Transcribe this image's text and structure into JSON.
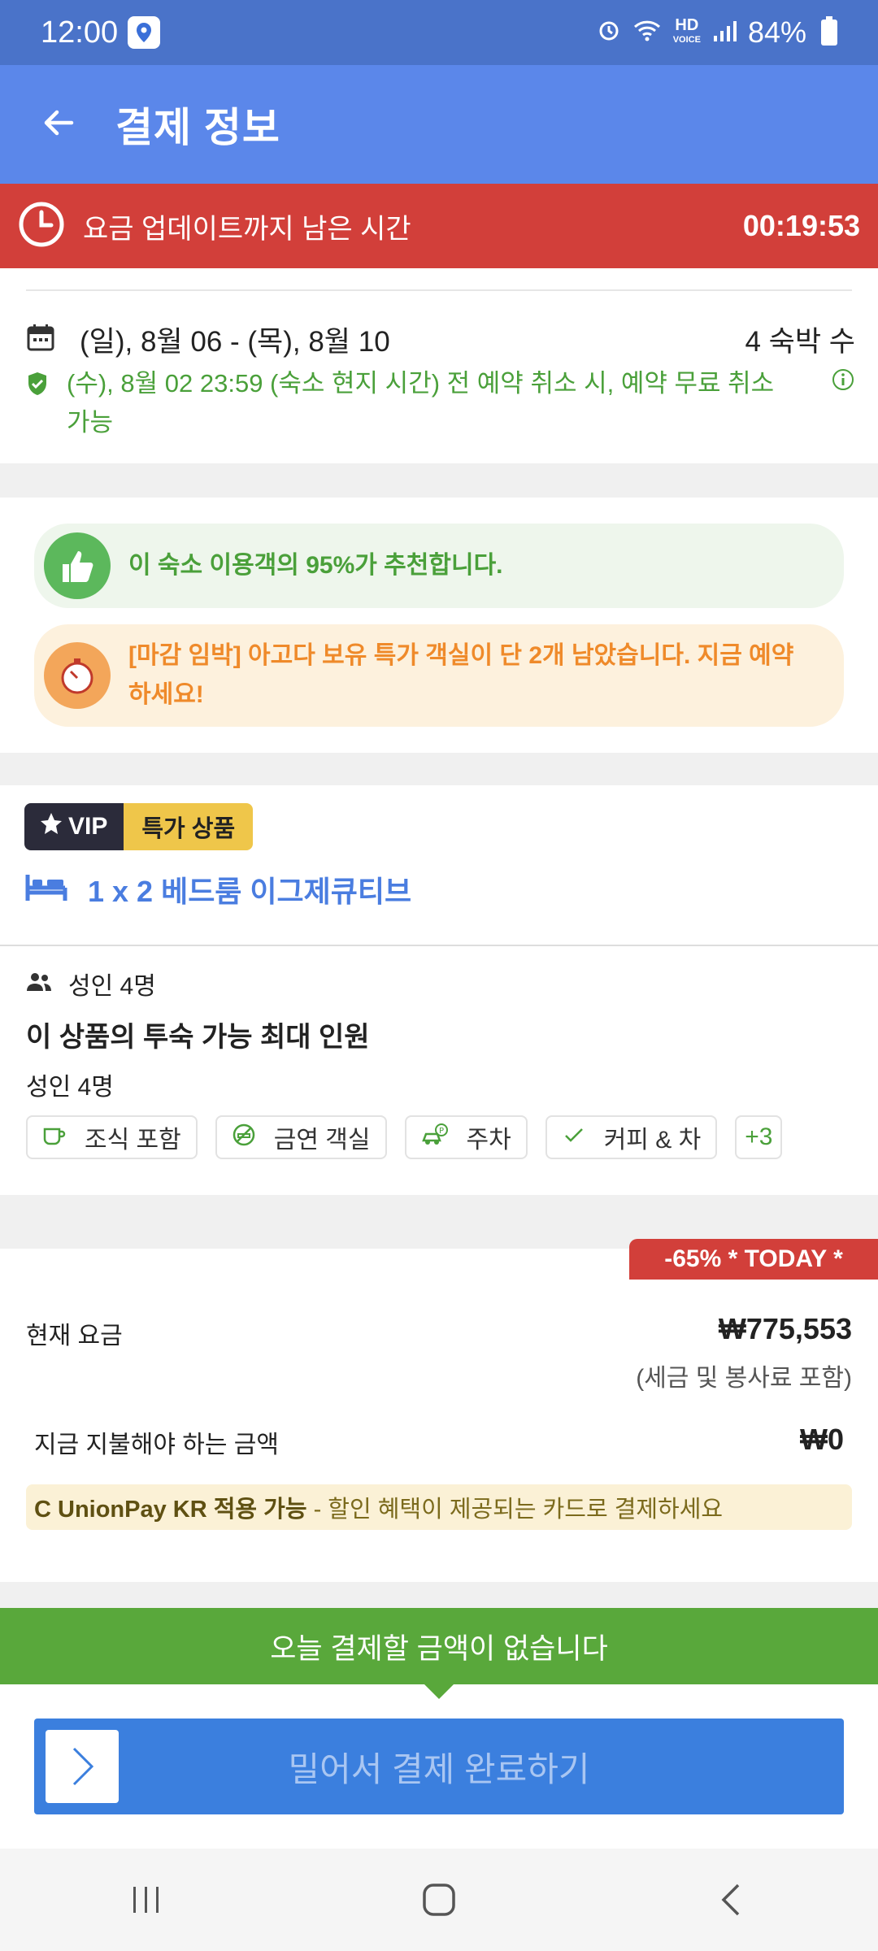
{
  "status_bar": {
    "time": "12:00",
    "battery": "84%",
    "hd_label": "HD",
    "voice_label": "VOICE"
  },
  "app_bar": {
    "title": "결제 정보"
  },
  "timer": {
    "label": "요금 업데이트까지 남은 시간",
    "value": "00:19:53"
  },
  "booking": {
    "dates": "(일), 8월 06 - (목), 8월 10",
    "nights": "4 숙박 수",
    "cancellation": "(수), 8월 02 23:59 (숙소 현지 시간) 전 예약 취소 시, 예약 무료 취소 가능"
  },
  "highlights": {
    "recommend": "이 숙소 이용객의 95%가 추천합니다.",
    "urgency": "[마감 임박] 아고다 보유 특가 객실이 단 2개 남았습니다. 지금 예약하세요!"
  },
  "room": {
    "vip_label": "VIP",
    "deal_label": "특가 상품",
    "name": "1 x 2 베드룸 이그제큐티브",
    "guests": "성인 4명",
    "max_title": "이 상품의 투숙 가능 최대 인원",
    "max_value": "성인 4명",
    "amenities": [
      "조식 포함",
      "금연 객실",
      "주차",
      "커피 & 차"
    ],
    "more_amenities": "+3"
  },
  "price": {
    "discount": "-65% * TODAY *",
    "current_label": "현재 요금",
    "current_value": "₩775,553",
    "tax_note": "(세금 및 봉사료 포함)",
    "pay_now_label": "지금 지불해야 하는 금액",
    "pay_now_value": "₩0",
    "promo_bold": "C UnionPay KR 적용 가능",
    "promo_rest": " - 할인 혜택이 제공되는 카드로 결제하세요"
  },
  "footer": {
    "notice": "오늘 결제할 금액이 없습니다",
    "slide_label": "밀어서 결제 완료하기"
  },
  "colors": {
    "primary_blue": "#5b87ea",
    "timer_red": "#d23f3a",
    "success_green": "#59a83b",
    "room_link_blue": "#4a7de0"
  }
}
